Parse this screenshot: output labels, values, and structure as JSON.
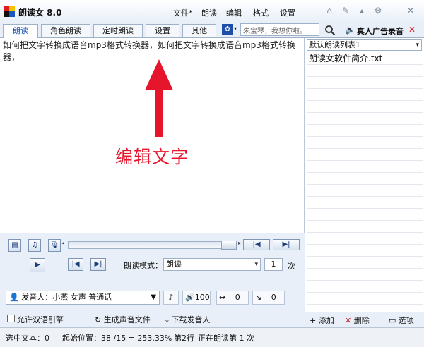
{
  "app": {
    "title": "朗读女 8.0"
  },
  "menu": [
    "文件*",
    "朗读",
    "编辑",
    "格式",
    "设置"
  ],
  "tabs": [
    "朗读",
    "角色朗读",
    "定时朗读",
    "设置",
    "其他"
  ],
  "voice_search": {
    "value": "朱宝琴，我想你啦。"
  },
  "real_voice_ad": "真人广告录音",
  "editor": {
    "text": "如何把文字转换成语音mp3格式转换器，如何把文字转换成语音mp3格式转换器，",
    "overlay_label": "编辑文字"
  },
  "playlist": {
    "selected": "默认朗读列表1",
    "items": [
      "朗读女软件简介.txt"
    ]
  },
  "right_footer": {
    "add": "添加",
    "delete": "删除",
    "options": "选项"
  },
  "controls": {
    "read_mode_label": "朗读模式：",
    "read_mode_value": "朗读",
    "repeat_count": "1",
    "repeat_unit": "次",
    "speaker": "发音人：小燕 女声 普通话",
    "volume": "100",
    "speed": "0",
    "pitch": "0",
    "allow_quotes": "允许双语引擎",
    "generate_audio": "生成声音文件",
    "download_speaker": "下载发音人"
  },
  "status": {
    "selected": "选中文本：0",
    "start_pos": "起始位置：38 /15 = 253.33%",
    "line": "第2行",
    "reading": "正在朗读第 1 次"
  },
  "colors": {
    "accent": "#1a55b8",
    "overlay": "#e5152b"
  }
}
